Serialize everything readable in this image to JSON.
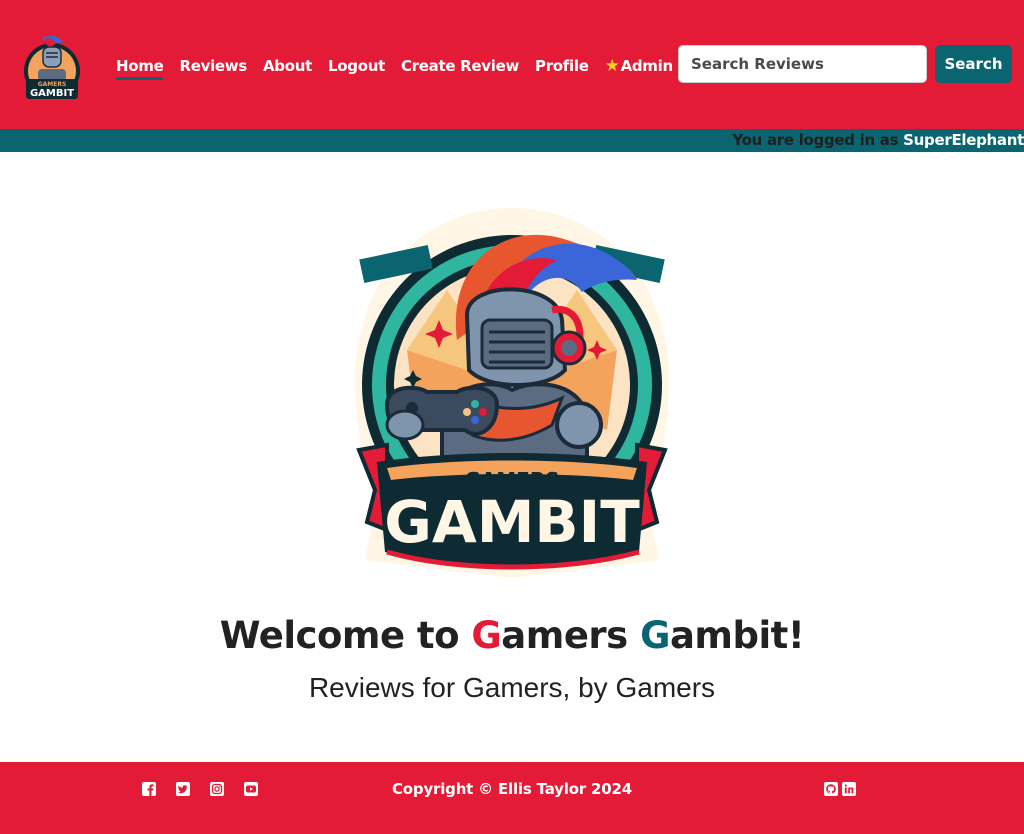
{
  "brand": {
    "logo_top": "GAMERS",
    "logo_bottom": "GAMBIT"
  },
  "nav": {
    "items": [
      {
        "label": "Home",
        "active": true
      },
      {
        "label": "Reviews"
      },
      {
        "label": "About"
      },
      {
        "label": "Logout"
      },
      {
        "label": "Create Review"
      },
      {
        "label": "Profile"
      }
    ],
    "admin_label": "Admin",
    "admin_icon": "star-icon"
  },
  "search": {
    "placeholder": "Search Reviews",
    "button_label": "Search"
  },
  "login": {
    "prefix": "You are logged in as ",
    "username": "SuperElephant"
  },
  "hero": {
    "logo_top": "GAMERS",
    "logo_bottom": "GAMBIT",
    "welcome_1": "Welcome to ",
    "g1": "G",
    "word1": "amers ",
    "g2": "G",
    "word2": "ambit!",
    "tagline": "Reviews for Gamers, by Gamers"
  },
  "footer": {
    "copyright": "Copyright © Ellis Taylor 2024",
    "social_left": [
      "facebook-icon",
      "twitter-icon",
      "instagram-icon",
      "youtube-icon"
    ],
    "social_right": [
      "github-icon",
      "linkedin-icon"
    ]
  },
  "colors": {
    "primary_red": "#e31b37",
    "teal": "#0b6571",
    "star_yellow": "#ffd21a"
  }
}
